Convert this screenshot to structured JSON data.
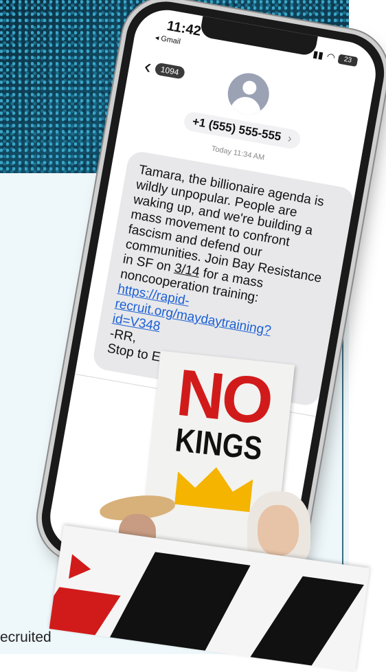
{
  "statusbar": {
    "time": "11:42",
    "back_app": "◂ Gmail",
    "battery": "23"
  },
  "conversation": {
    "back_count": "1094",
    "contact": "+1 (555) 555-555",
    "timestamp": "Today 11:34 AM"
  },
  "message": {
    "text_before_date": "Tamara, the billionaire agenda is wildly unpopular. People are waking up, and we're building a mass movement to confront fascism and defend our communities. Join Bay Resistance in SF on ",
    "date": "3/14",
    "text_after_date": " for a mass noncooperation training:",
    "link": "https://rapid-recruit.org/maydaytraining?id=V348",
    "signature": "-RR,",
    "footer": "Stop to End"
  },
  "sign": {
    "line1": "NO",
    "line2": "KINGS"
  },
  "caption": "ecruited",
  "colors": {
    "link": "#1a5fd6",
    "bubble": "#e8e8ea",
    "sign_red": "#d11b1b"
  }
}
